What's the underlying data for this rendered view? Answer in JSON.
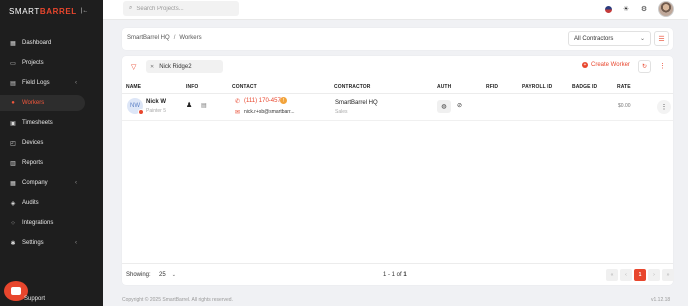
{
  "brand": {
    "name_light": "SMART",
    "name_bold": "BARREL",
    "collapse_icon": "chevron-left-bar-icon"
  },
  "topbar": {
    "search_placeholder": "Search Projects...",
    "icons": [
      "flag-icon",
      "theme-toggle-icon",
      "settings-icon",
      "user-avatar"
    ]
  },
  "sidebar": {
    "items": [
      {
        "label": "Dashboard",
        "icon": "dashboard-icon",
        "active": false,
        "chevron": false
      },
      {
        "label": "Projects",
        "icon": "folder-icon",
        "active": false,
        "chevron": false
      },
      {
        "label": "Field Logs",
        "icon": "clipboard-icon",
        "active": false,
        "chevron": true
      },
      {
        "label": "Workers",
        "icon": "person-icon",
        "active": true,
        "chevron": false
      },
      {
        "label": "Timesheets",
        "icon": "calendar-icon",
        "active": false,
        "chevron": false
      },
      {
        "label": "Devices",
        "icon": "device-icon",
        "active": false,
        "chevron": false
      },
      {
        "label": "Reports",
        "icon": "report-icon",
        "active": false,
        "chevron": false
      },
      {
        "label": "Company",
        "icon": "building-icon",
        "active": false,
        "chevron": true
      },
      {
        "label": "Audits",
        "icon": "audit-icon",
        "active": false,
        "chevron": false
      },
      {
        "label": "Integrations",
        "icon": "integration-icon",
        "active": false,
        "chevron": false
      },
      {
        "label": "Settings",
        "icon": "gear-icon",
        "active": false,
        "chevron": true
      }
    ],
    "support_label": "Support"
  },
  "breadcrumb": {
    "root": "SmartBarrel HQ",
    "separator": "/",
    "current": "Workers"
  },
  "contractor_filter": {
    "selected": "All Contractors"
  },
  "toolbar": {
    "filter_chip": "Nick Ridge2",
    "create_label": "Create Worker"
  },
  "table": {
    "headers": {
      "name": "NAME",
      "info": "INFO",
      "contact": "CONTACT",
      "contractor": "CONTRACTOR",
      "auth": "AUTH",
      "rfid": "RFID",
      "payroll": "PAYROLL ID",
      "badge": "BADGE ID",
      "rate": "RATE"
    },
    "rows": [
      {
        "initials": "NW",
        "name": "Nick W",
        "role": "Painter 5",
        "phone": "(111) 170-4578",
        "email": "nick.r+sb@smartbarr...",
        "contractor": "SmartBarrel HQ",
        "contractor_sub": "Sales",
        "rfid": "",
        "payroll_id": "",
        "badge_id": "",
        "rate": "$0.00"
      }
    ]
  },
  "pagination": {
    "showing_label": "Showing:",
    "page_size": "25",
    "range_prefix": "1 - 1 of ",
    "total": "1",
    "current_page": "1"
  },
  "footer": {
    "copyright": "Copyright © 2025 SmartBarrel. All rights reserved.",
    "version": "v1.12.18"
  },
  "colors": {
    "accent": "#e8462d",
    "sidebar_bg": "#1e1e1e",
    "page_bg": "#f0f1f4"
  }
}
